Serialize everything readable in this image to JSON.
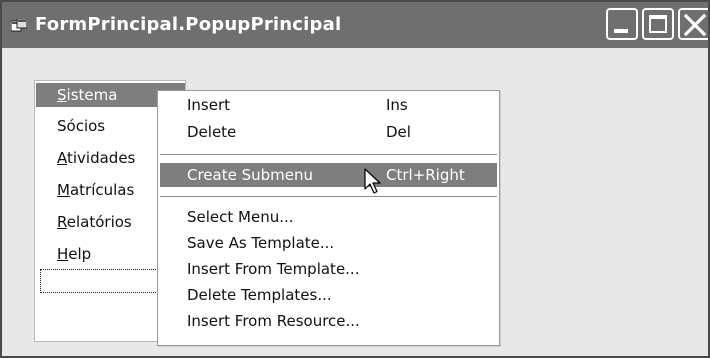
{
  "window": {
    "title": "FormPrincipal.PopupPrincipal",
    "icon": "app-form-icon",
    "controls": {
      "minimize_icon": "minimize-icon",
      "maximize_icon": "maximize-icon",
      "close_icon": "close-icon"
    }
  },
  "menu_panel": {
    "items": [
      {
        "hotkey": "S",
        "rest": "istema",
        "selected": true
      },
      {
        "hotkey": "",
        "rest": "Sócios",
        "selected": false
      },
      {
        "hotkey": "A",
        "rest": "tividades",
        "selected": false
      },
      {
        "hotkey": "M",
        "rest": "atrículas",
        "selected": false
      },
      {
        "hotkey": "R",
        "rest": "elatórios",
        "selected": false
      },
      {
        "hotkey": "H",
        "rest": "elp",
        "selected": false
      }
    ]
  },
  "popup_menu": {
    "groups": [
      [
        {
          "label": "Insert",
          "shortcut": "Ins"
        },
        {
          "label": "Delete",
          "shortcut": "Del"
        }
      ],
      [
        {
          "label": "Create Submenu",
          "shortcut": "Ctrl+Right",
          "highlighted": true
        }
      ],
      [
        {
          "label": "Select Menu...",
          "shortcut": ""
        },
        {
          "label": "Save As Template...",
          "shortcut": ""
        },
        {
          "label": "Insert From Template...",
          "shortcut": ""
        },
        {
          "label": "Delete Templates...",
          "shortcut": ""
        },
        {
          "label": "Insert From Resource...",
          "shortcut": ""
        }
      ]
    ]
  },
  "colors": {
    "titlebar": "#6f6f6f",
    "highlight": "#7e7e7e",
    "background": "#e8e8e8"
  }
}
